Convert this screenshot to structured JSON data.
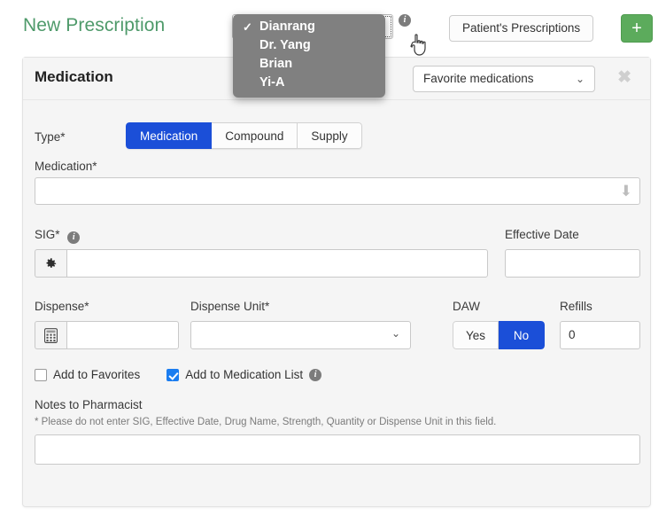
{
  "header": {
    "page_title": "New Prescription",
    "provider_info_icon": "info-icon",
    "patient_prescriptions_label": "Patient's Prescriptions",
    "add_button_label": "+",
    "add_button_color": "#5cab5c",
    "title_color": "#4e9a6a"
  },
  "provider_dropdown": {
    "open": true,
    "selected": "Dianrang",
    "check_glyph": "✓",
    "chevron_glyph": "⌄",
    "options": [
      {
        "label": "Dianrang",
        "selected": true
      },
      {
        "label": "Dr. Yang",
        "selected": false
      },
      {
        "label": "Brian",
        "selected": false
      },
      {
        "label": "Yi-A",
        "selected": false
      }
    ]
  },
  "card": {
    "title": "Medication",
    "favorite_select_value": "Favorite medications",
    "favorite_chevron": "⌄",
    "close_glyph": "✖"
  },
  "form": {
    "type": {
      "label": "Type*",
      "options": [
        {
          "label": "Medication",
          "active": true
        },
        {
          "label": "Compound",
          "active": false
        },
        {
          "label": "Supply",
          "active": false
        }
      ],
      "active_color": "#1b4fd8"
    },
    "medication": {
      "label": "Medication*",
      "value": "",
      "arrow_glyph": "⬇"
    },
    "sig": {
      "label": "SIG*",
      "info_icon": "info-icon",
      "gear_icon": "gear-icon",
      "value": ""
    },
    "effective_date": {
      "label": "Effective Date",
      "value": ""
    },
    "dispense": {
      "label": "Dispense*",
      "calculator_icon": "calculator-icon",
      "value": ""
    },
    "dispense_unit": {
      "label": "Dispense Unit*",
      "value": "",
      "chevron_glyph": "⌄"
    },
    "daw": {
      "label": "DAW",
      "options": [
        {
          "label": "Yes",
          "active": false
        },
        {
          "label": "No",
          "active": true
        }
      ]
    },
    "refills": {
      "label": "Refills",
      "value": "0"
    },
    "checkboxes": [
      {
        "label": "Add to Favorites",
        "checked": false,
        "has_info": false
      },
      {
        "label": "Add to Medication List",
        "checked": true,
        "has_info": true
      }
    ],
    "notes": {
      "label": "Notes to Pharmacist",
      "hint": "* Please do not enter SIG, Effective Date, Drug Name, Strength, Quantity or Dispense Unit in this field.",
      "value": ""
    }
  }
}
